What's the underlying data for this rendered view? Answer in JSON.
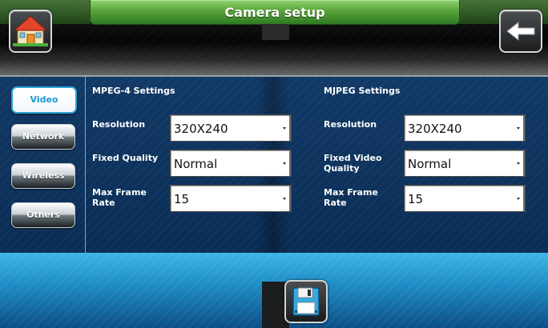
{
  "header": {
    "title": "Camera setup",
    "home_icon": "home-icon",
    "back_icon": "back-arrow-icon"
  },
  "sidebar": {
    "items": [
      {
        "label": "Video",
        "active": true
      },
      {
        "label": "Network",
        "active": false
      },
      {
        "label": "Wireless",
        "active": false
      },
      {
        "label": "Others",
        "active": false
      }
    ]
  },
  "mpeg4": {
    "title": "MPEG-4 Settings",
    "resolution_label": "Resolution",
    "resolution_value": "320X240",
    "quality_label": "Fixed Quality",
    "quality_value": "Normal",
    "framerate_label": "Max Frame Rate",
    "framerate_value": "15"
  },
  "mjpeg": {
    "title": "MJPEG Settings",
    "resolution_label": "Resolution",
    "resolution_value": "320X240",
    "quality_label": "Fixed Video Quality",
    "quality_value": "Normal",
    "framerate_label": "Max Frame Rate",
    "framerate_value": "15"
  },
  "footer": {
    "save_icon": "save-disk-icon"
  },
  "colors": {
    "title_bar": "#5aa43b",
    "active_tab_border": "#2ea5d8",
    "active_tab_text": "#1b9ad3",
    "main_bg": "#0a2d55",
    "footer_bg": "#1f8fc7"
  }
}
